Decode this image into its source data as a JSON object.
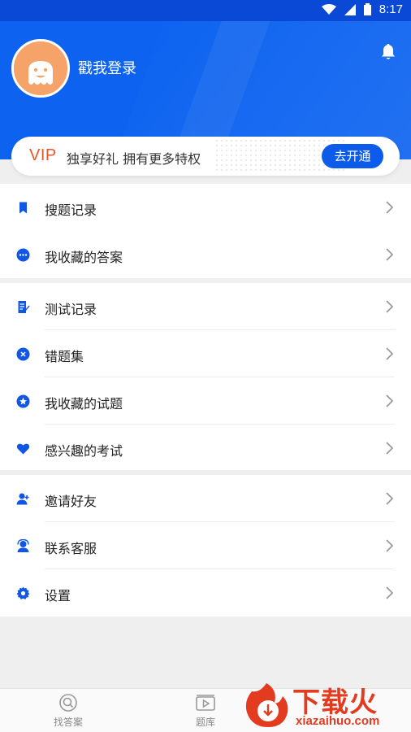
{
  "status_bar": {
    "time": "8:17",
    "icons": [
      "wifi-icon",
      "signal-icon",
      "battery-icon"
    ]
  },
  "header": {
    "login_text": "戳我登录",
    "bell_icon": "bell-icon"
  },
  "vip": {
    "tag": "VIP",
    "text": "独享好礼 拥有更多特权",
    "button": "去开通"
  },
  "menu_groups": [
    {
      "items": [
        {
          "label": "搜题记录",
          "icon": "bookmark-icon"
        },
        {
          "label": "我收藏的答案",
          "icon": "chat-icon"
        }
      ]
    },
    {
      "items": [
        {
          "label": "测试记录",
          "icon": "document-edit-icon"
        },
        {
          "label": "错题集",
          "icon": "close-circle-icon"
        },
        {
          "label": "我收藏的试题",
          "icon": "star-badge-icon"
        },
        {
          "label": "感兴趣的考试",
          "icon": "heart-icon"
        }
      ]
    },
    {
      "items": [
        {
          "label": "邀请好友",
          "icon": "add-user-icon"
        },
        {
          "label": "联系客服",
          "icon": "headset-icon"
        },
        {
          "label": "设置",
          "icon": "gear-icon"
        }
      ]
    }
  ],
  "tab_bar": {
    "tabs": [
      {
        "label": "找答案",
        "icon": "search-icon"
      },
      {
        "label": "题库",
        "icon": "video-library-icon"
      }
    ]
  },
  "watermark": {
    "title": "下载火",
    "subtitle": "xiazaihuo.com"
  },
  "colors": {
    "primary": "#0d63f0",
    "vip_tag": "#e8572a",
    "watermark": "#e33b1f"
  }
}
